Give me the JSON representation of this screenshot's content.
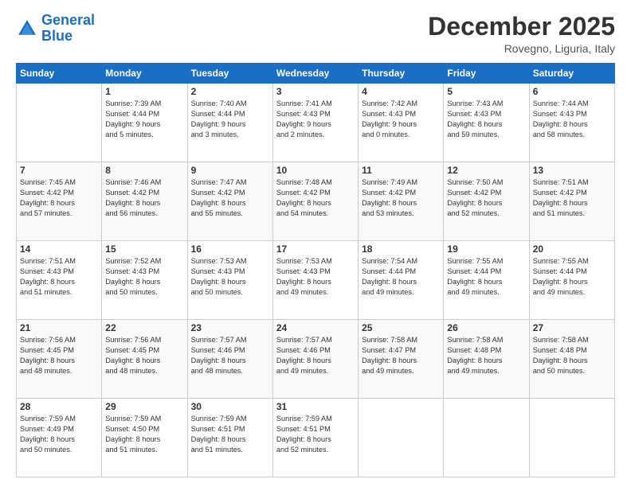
{
  "logo": {
    "line1": "General",
    "line2": "Blue"
  },
  "title": "December 2025",
  "location": "Rovegno, Liguria, Italy",
  "days_of_week": [
    "Sunday",
    "Monday",
    "Tuesday",
    "Wednesday",
    "Thursday",
    "Friday",
    "Saturday"
  ],
  "weeks": [
    [
      {
        "day": "",
        "info": ""
      },
      {
        "day": "1",
        "info": "Sunrise: 7:39 AM\nSunset: 4:44 PM\nDaylight: 9 hours\nand 5 minutes."
      },
      {
        "day": "2",
        "info": "Sunrise: 7:40 AM\nSunset: 4:44 PM\nDaylight: 9 hours\nand 3 minutes."
      },
      {
        "day": "3",
        "info": "Sunrise: 7:41 AM\nSunset: 4:43 PM\nDaylight: 9 hours\nand 2 minutes."
      },
      {
        "day": "4",
        "info": "Sunrise: 7:42 AM\nSunset: 4:43 PM\nDaylight: 9 hours\nand 0 minutes."
      },
      {
        "day": "5",
        "info": "Sunrise: 7:43 AM\nSunset: 4:43 PM\nDaylight: 8 hours\nand 59 minutes."
      },
      {
        "day": "6",
        "info": "Sunrise: 7:44 AM\nSunset: 4:43 PM\nDaylight: 8 hours\nand 58 minutes."
      }
    ],
    [
      {
        "day": "7",
        "info": "Sunrise: 7:45 AM\nSunset: 4:42 PM\nDaylight: 8 hours\nand 57 minutes."
      },
      {
        "day": "8",
        "info": "Sunrise: 7:46 AM\nSunset: 4:42 PM\nDaylight: 8 hours\nand 56 minutes."
      },
      {
        "day": "9",
        "info": "Sunrise: 7:47 AM\nSunset: 4:42 PM\nDaylight: 8 hours\nand 55 minutes."
      },
      {
        "day": "10",
        "info": "Sunrise: 7:48 AM\nSunset: 4:42 PM\nDaylight: 8 hours\nand 54 minutes."
      },
      {
        "day": "11",
        "info": "Sunrise: 7:49 AM\nSunset: 4:42 PM\nDaylight: 8 hours\nand 53 minutes."
      },
      {
        "day": "12",
        "info": "Sunrise: 7:50 AM\nSunset: 4:42 PM\nDaylight: 8 hours\nand 52 minutes."
      },
      {
        "day": "13",
        "info": "Sunrise: 7:51 AM\nSunset: 4:42 PM\nDaylight: 8 hours\nand 51 minutes."
      }
    ],
    [
      {
        "day": "14",
        "info": "Sunrise: 7:51 AM\nSunset: 4:43 PM\nDaylight: 8 hours\nand 51 minutes."
      },
      {
        "day": "15",
        "info": "Sunrise: 7:52 AM\nSunset: 4:43 PM\nDaylight: 8 hours\nand 50 minutes."
      },
      {
        "day": "16",
        "info": "Sunrise: 7:53 AM\nSunset: 4:43 PM\nDaylight: 8 hours\nand 50 minutes."
      },
      {
        "day": "17",
        "info": "Sunrise: 7:53 AM\nSunset: 4:43 PM\nDaylight: 8 hours\nand 49 minutes."
      },
      {
        "day": "18",
        "info": "Sunrise: 7:54 AM\nSunset: 4:44 PM\nDaylight: 8 hours\nand 49 minutes."
      },
      {
        "day": "19",
        "info": "Sunrise: 7:55 AM\nSunset: 4:44 PM\nDaylight: 8 hours\nand 49 minutes."
      },
      {
        "day": "20",
        "info": "Sunrise: 7:55 AM\nSunset: 4:44 PM\nDaylight: 8 hours\nand 49 minutes."
      }
    ],
    [
      {
        "day": "21",
        "info": "Sunrise: 7:56 AM\nSunset: 4:45 PM\nDaylight: 8 hours\nand 48 minutes."
      },
      {
        "day": "22",
        "info": "Sunrise: 7:56 AM\nSunset: 4:45 PM\nDaylight: 8 hours\nand 48 minutes."
      },
      {
        "day": "23",
        "info": "Sunrise: 7:57 AM\nSunset: 4:46 PM\nDaylight: 8 hours\nand 48 minutes."
      },
      {
        "day": "24",
        "info": "Sunrise: 7:57 AM\nSunset: 4:46 PM\nDaylight: 8 hours\nand 49 minutes."
      },
      {
        "day": "25",
        "info": "Sunrise: 7:58 AM\nSunset: 4:47 PM\nDaylight: 8 hours\nand 49 minutes."
      },
      {
        "day": "26",
        "info": "Sunrise: 7:58 AM\nSunset: 4:48 PM\nDaylight: 8 hours\nand 49 minutes."
      },
      {
        "day": "27",
        "info": "Sunrise: 7:58 AM\nSunset: 4:48 PM\nDaylight: 8 hours\nand 50 minutes."
      }
    ],
    [
      {
        "day": "28",
        "info": "Sunrise: 7:59 AM\nSunset: 4:49 PM\nDaylight: 8 hours\nand 50 minutes."
      },
      {
        "day": "29",
        "info": "Sunrise: 7:59 AM\nSunset: 4:50 PM\nDaylight: 8 hours\nand 51 minutes."
      },
      {
        "day": "30",
        "info": "Sunrise: 7:59 AM\nSunset: 4:51 PM\nDaylight: 8 hours\nand 51 minutes."
      },
      {
        "day": "31",
        "info": "Sunrise: 7:59 AM\nSunset: 4:51 PM\nDaylight: 8 hours\nand 52 minutes."
      },
      {
        "day": "",
        "info": ""
      },
      {
        "day": "",
        "info": ""
      },
      {
        "day": "",
        "info": ""
      }
    ]
  ]
}
